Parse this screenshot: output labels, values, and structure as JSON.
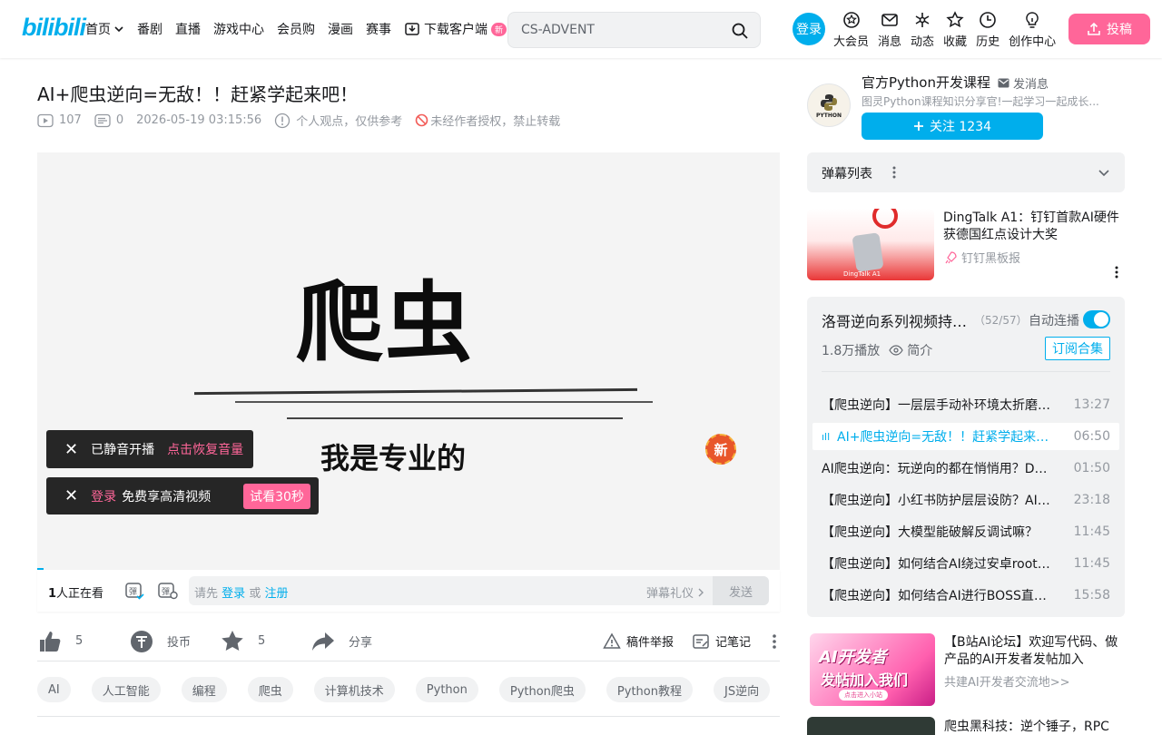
{
  "header": {
    "logo": "bilibili",
    "nav": [
      {
        "label": "首页",
        "dropdown": true
      },
      {
        "label": "番剧"
      },
      {
        "label": "直播"
      },
      {
        "label": "游戏中心"
      },
      {
        "label": "会员购"
      },
      {
        "label": "漫画"
      },
      {
        "label": "赛事"
      },
      {
        "label": "下载客户端",
        "badge": "新"
      }
    ],
    "search_value": "CS-ADVENT",
    "login": "登录",
    "icons": [
      {
        "icon": "vip-icon",
        "label": "大会员"
      },
      {
        "icon": "message-icon",
        "label": "消息"
      },
      {
        "icon": "dynamic-icon",
        "label": "动态"
      },
      {
        "icon": "star-icon",
        "label": "收藏"
      },
      {
        "icon": "clock-icon",
        "label": "历史"
      },
      {
        "icon": "bulb-icon",
        "label": "创作中心"
      }
    ],
    "upload": "投稿",
    "accent": "#00aeec",
    "pink": "#ff6699"
  },
  "video": {
    "title": "AI+爬虫逆向=无敌！！赶紧学起来吧！",
    "plays": "107",
    "danmaku": "0",
    "datetime": "2026-05-19 03:15:56",
    "opinion": "个人观点，仅供参考",
    "no_repost": "未经作者授权，禁止转载",
    "frame_main": "爬虫",
    "frame_sub": "我是专业的",
    "frame_badge": "新",
    "toast_muted": "已静音开播",
    "toast_restore": "点击恢复音量",
    "toast_login": "登录",
    "toast_hd": "免费享高清视频",
    "toast_try": "试看30秒",
    "watching_count": "1",
    "watching_text": "人正在看",
    "dm_placeholder_pre": "请先",
    "dm_login": "登录",
    "dm_or": "或",
    "dm_register": "注册",
    "dm_etiquette": "弹幕礼仪",
    "dm_send": "发送"
  },
  "toolbar": {
    "like": "5",
    "coin": "投币",
    "fav": "5",
    "share": "分享",
    "report": "稿件举报",
    "notes": "记笔记"
  },
  "tags": [
    "AI",
    "人工智能",
    "编程",
    "爬虫",
    "计算机技术",
    "Python",
    "Python爬虫",
    "Python教程",
    "JS逆向"
  ],
  "uploader": {
    "avatar_text": "PYTHON",
    "name": "官方Python开发课程",
    "message": "发消息",
    "desc": "图灵Python课程知识分享官!一起学习一起成长...",
    "follow": "关注 1234"
  },
  "danmaku_list": {
    "title": "弹幕列表"
  },
  "ad1": {
    "title": "DingTalk A1：钉钉首款AI硬件获德国红点设计大奖",
    "source": "钉钉黑板报",
    "thumb_label": "DingTalk A1"
  },
  "series": {
    "title": "洛哥逆向系列视频持…",
    "count": "（52/57）",
    "autoplay": "自动连播",
    "plays": "1.8万播放",
    "intro": "简介",
    "subscribe": "订阅合集",
    "episodes": [
      {
        "title": "【爬虫逆向】一层层手动补环境太折磨…",
        "duration": "13:27",
        "active": false
      },
      {
        "title": "AI+爬虫逆向=无敌！！赶紧学起来…",
        "duration": "06:50",
        "active": true
      },
      {
        "title": "AI爬虫逆向：玩逆向的都在悄悄用？D…",
        "duration": "01:50",
        "active": false
      },
      {
        "title": "【爬虫逆向】小红书防护层层设防？AI…",
        "duration": "23:18",
        "active": false
      },
      {
        "title": "【爬虫逆向】大模型能破解反调试嘛？",
        "duration": "11:45",
        "active": false
      },
      {
        "title": "【爬虫逆向】如何结合AI绕过安卓root…",
        "duration": "11:45",
        "active": false
      },
      {
        "title": "【爬虫逆向】如何结合AI进行BOSS直…",
        "duration": "15:58",
        "active": false
      }
    ]
  },
  "ad2": {
    "title": "【B站AI论坛】欢迎写代码、做产品的AI开发者发帖加入",
    "source": "共建AI开发者交流地>>",
    "thumb_big": "AI开发者",
    "thumb_big2": "发帖加入我们",
    "thumb_pill": "点击进入小站"
  },
  "ad3": {
    "title": "爬虫黑科技：逆个锤子，RPC"
  }
}
